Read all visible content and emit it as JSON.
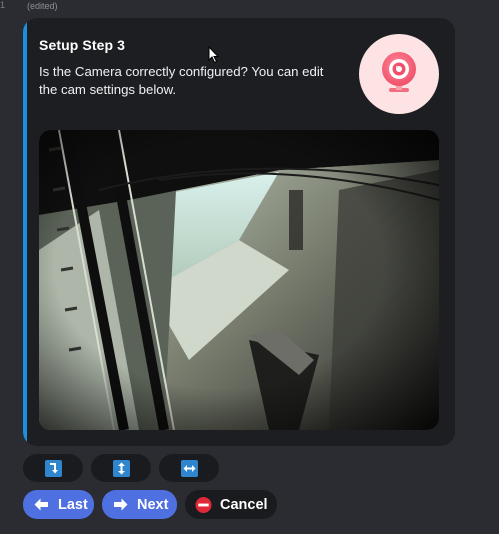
{
  "message": {
    "edited_label": "(edited)",
    "gutter_mark": "1"
  },
  "card": {
    "title": "Setup Step 3",
    "text": "Is the Camera correctly configured? You can edit the cam settings below.",
    "accent_color": "#1e8fe0",
    "avatar_icon": "webcam-icon"
  },
  "controls": [
    {
      "name": "rotate-button",
      "icon": "rotate-icon"
    },
    {
      "name": "flip-vertical-button",
      "icon": "flip-vertical-icon"
    },
    {
      "name": "flip-horizontal-button",
      "icon": "flip-horizontal-icon"
    }
  ],
  "navigation": {
    "last_label": "Last",
    "next_label": "Next",
    "cancel_label": "Cancel",
    "primary_color": "#4f70e0"
  }
}
